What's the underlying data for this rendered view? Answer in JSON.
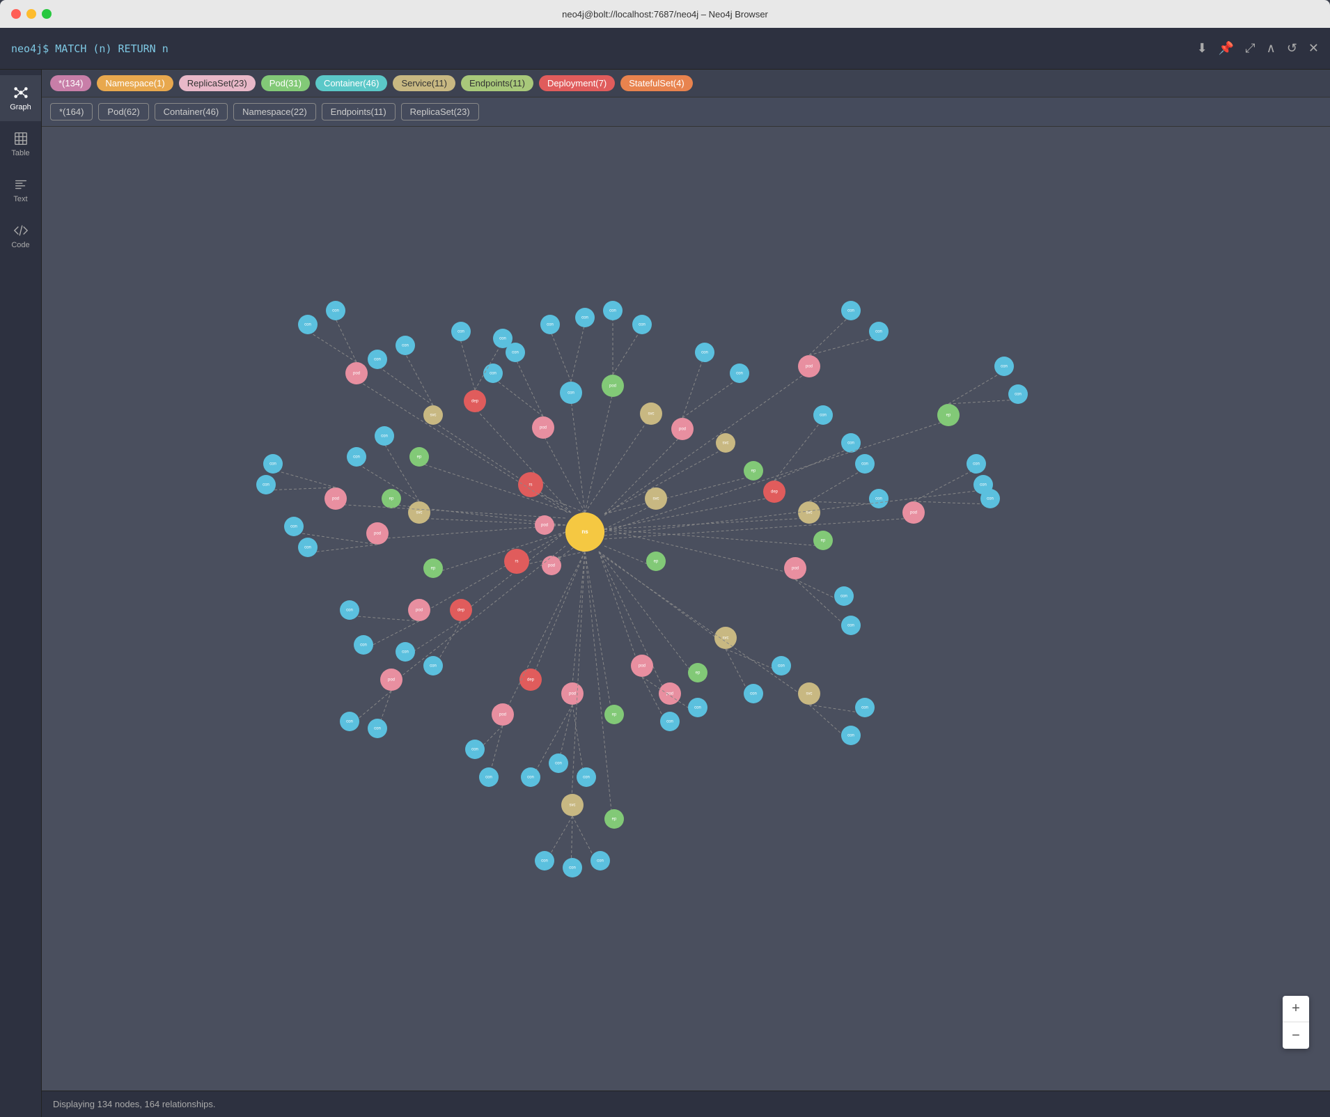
{
  "titleBar": {
    "title": "neo4j@bolt://localhost:7687/neo4j – Neo4j Browser",
    "buttons": {
      "close": "×",
      "minimize": "–",
      "maximize": "+"
    }
  },
  "queryBar": {
    "prompt": "neo4j$  MATCH  (n)  RETURN  n",
    "actions": [
      "download",
      "pin",
      "collapse",
      "up",
      "refresh",
      "close"
    ]
  },
  "sidebar": {
    "items": [
      {
        "id": "graph",
        "label": "Graph",
        "icon": "graph"
      },
      {
        "id": "table",
        "label": "Table",
        "icon": "table"
      },
      {
        "id": "text",
        "label": "Text",
        "icon": "text"
      },
      {
        "id": "code",
        "label": "Code",
        "icon": "code"
      }
    ]
  },
  "legendBar1": {
    "tags": [
      {
        "label": "*(134)",
        "color": "#c87ea8",
        "textColor": "#fff"
      },
      {
        "label": "Namespace(1)",
        "color": "#e8a84e",
        "textColor": "#fff"
      },
      {
        "label": "ReplicaSet(23)",
        "color": "#e8a8b8",
        "textColor": "#333"
      },
      {
        "label": "Pod(31)",
        "color": "#82c977",
        "textColor": "#fff"
      },
      {
        "label": "Container(46)",
        "color": "#5bc8c8",
        "textColor": "#fff"
      },
      {
        "label": "Service(11)",
        "color": "#c8b882",
        "textColor": "#333"
      },
      {
        "label": "Endpoints(11)",
        "color": "#a8c87a",
        "textColor": "#333"
      },
      {
        "label": "Deployment(7)",
        "color": "#e05c5c",
        "textColor": "#fff"
      },
      {
        "label": "StatefulSet(4)",
        "color": "#e8834e",
        "textColor": "#fff"
      }
    ]
  },
  "legendBar2": {
    "tags": [
      {
        "label": "*(164)"
      },
      {
        "label": "Pod(62)"
      },
      {
        "label": "Container(46)"
      },
      {
        "label": "Namespace(22)"
      },
      {
        "label": "Endpoints(11)"
      },
      {
        "label": "ReplicaSet(23)"
      }
    ]
  },
  "statusBar": {
    "text": "Displaying 134 nodes, 164 relationships."
  },
  "zoomControls": {
    "zoomIn": "+",
    "zoomOut": "−"
  }
}
